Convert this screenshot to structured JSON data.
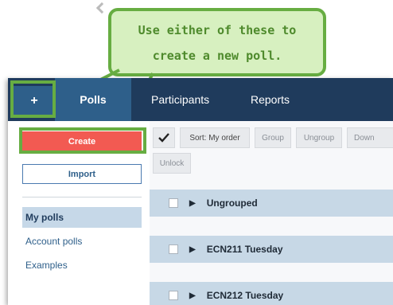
{
  "callout": {
    "line1": "Use either of these to",
    "line2": "create a new poll."
  },
  "topnav": {
    "add": "+",
    "tabs": [
      "Polls",
      "Participants",
      "Reports"
    ]
  },
  "sidebar": {
    "create_label": "Create",
    "import_label": "Import",
    "items": [
      "My polls",
      "Account polls",
      "Examples"
    ]
  },
  "toolbar": {
    "select_all_icon": "checkmark-icon",
    "sort_label": "Sort: My order",
    "group_label": "Group",
    "ungroup_label": "Ungroup",
    "down_label": "Down",
    "unlock_label": "Unlock"
  },
  "groups": [
    {
      "label": "Ungrouped"
    },
    {
      "label": "ECN211 Tuesday"
    },
    {
      "label": "ECN212 Tuesday"
    }
  ],
  "colors": {
    "nav": "#1f3b5c",
    "nav_active": "#2e5f8a",
    "create": "#f25a52",
    "highlight": "#67ad42",
    "callout_fill": "#d7f0c0"
  }
}
